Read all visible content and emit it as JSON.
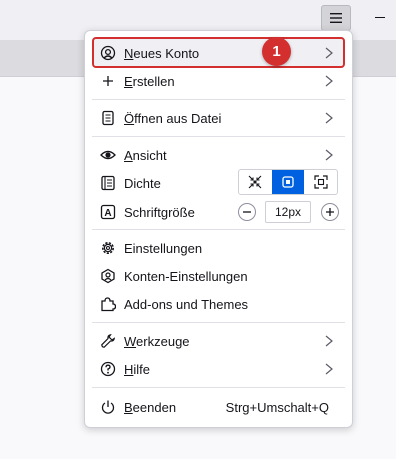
{
  "menu": {
    "new_account": "Neues Konto",
    "new_account_access": "N",
    "new_account_rest": "eues Konto",
    "create_access": "E",
    "create_rest": "rstellen",
    "open_access": "Ö",
    "open_rest": "ffnen aus Datei",
    "view_access": "A",
    "view_rest": "nsicht",
    "density": "Dichte",
    "font_size": "Schriftgröße",
    "font_size_value": "12px",
    "settings": "Einstellungen",
    "account_settings": "Konten-Einstellungen",
    "addons": "Add-ons und Themes",
    "tools_access": "W",
    "tools_rest": "erkzeuge",
    "help_access": "H",
    "help_rest": "ilfe",
    "quit_access": "B",
    "quit_rest": "eenden",
    "quit_shortcut": "Strg+Umschalt+Q"
  },
  "annotation": {
    "badge": "1",
    "color": "#d32f2f"
  },
  "density_options": [
    "compact",
    "normal",
    "touch"
  ],
  "density_selected": "normal",
  "accent": "#0061e0"
}
